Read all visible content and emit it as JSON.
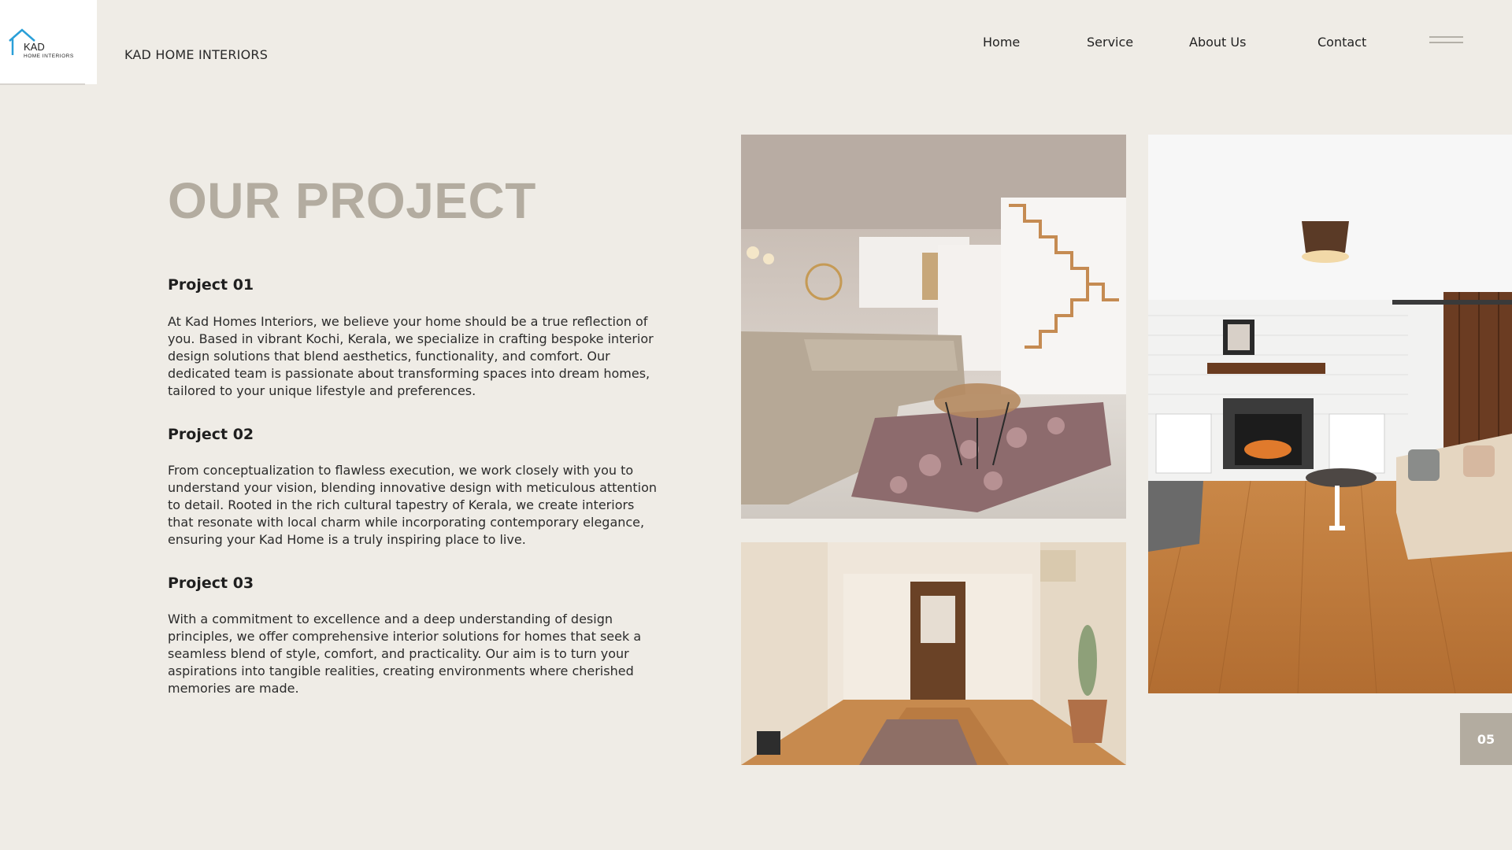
{
  "brand": {
    "name": "KAD HOME INTERIORS",
    "logo_text_main": "KAD",
    "logo_text_sub": "HOME INTERIORS"
  },
  "nav": {
    "home": "Home",
    "service": "Service",
    "about": "About Us",
    "contact": "Contact"
  },
  "section": {
    "title": "OUR PROJECT"
  },
  "projects": [
    {
      "heading": "Project 01",
      "text": "At Kad Homes Interiors, we believe your home should be a true reflection of you. Based in vibrant Kochi, Kerala, we specialize in crafting bespoke interior design solutions that blend aesthetics, functionality, and comfort. Our dedicated team is passionate about transforming spaces into dream homes, tailored to your unique lifestyle and preferences."
    },
    {
      "heading": "Project 02",
      "text": "From conceptualization to flawless execution, we work closely with you to understand your vision, blending innovative design with meticulous attention to detail. Rooted in the rich cultural tapestry of Kerala, we create interiors that resonate with local charm while incorporating contemporary elegance, ensuring your Kad Home is a truly inspiring place to live."
    },
    {
      "heading": "Project 03",
      "text": "With a commitment to excellence and a deep understanding of design principles, we offer comprehensive interior solutions for homes that seek a seamless blend of style, comfort, and practicality. Our aim is to turn your aspirations into tangible realities, creating environments where cherished memories are made."
    }
  ],
  "page_number": "05",
  "colors": {
    "background": "#efece6",
    "accent": "#b3aca0",
    "logo_blue": "#2a9fd8"
  }
}
